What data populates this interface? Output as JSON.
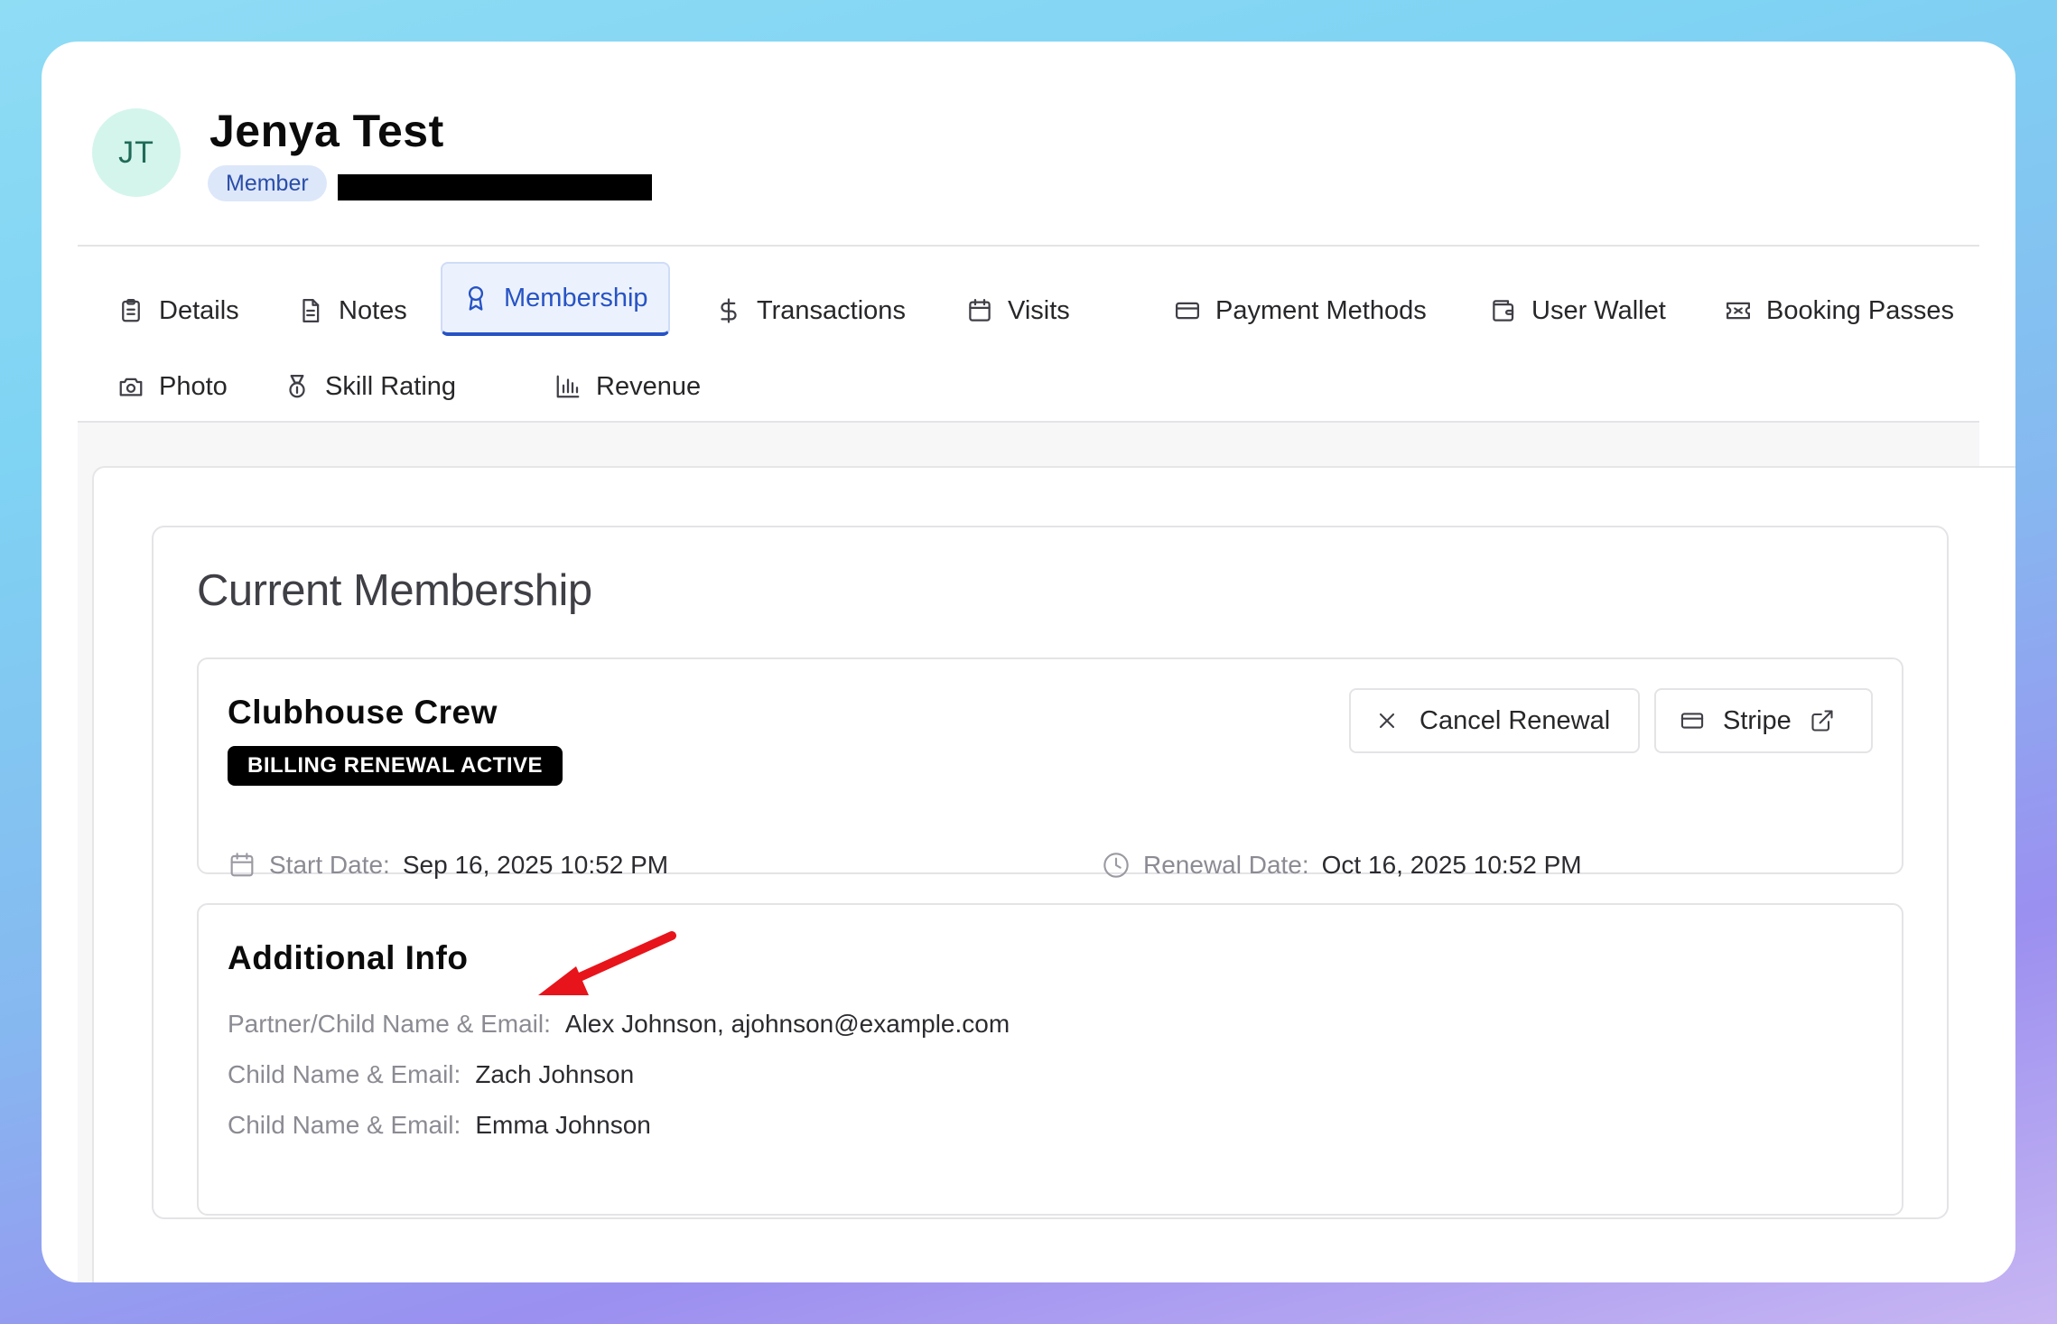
{
  "user": {
    "initials": "JT",
    "name": "Jenya Test",
    "role": "Member"
  },
  "tabs": [
    {
      "label": "Details",
      "icon": "clipboard-icon",
      "active": false
    },
    {
      "label": "Notes",
      "icon": "document-icon",
      "active": false
    },
    {
      "label": "Membership",
      "icon": "award-icon",
      "active": true
    },
    {
      "label": "Transactions",
      "icon": "dollar-icon",
      "active": false
    },
    {
      "label": "Visits",
      "icon": "calendar-icon",
      "active": false
    },
    {
      "label": "Payment Methods",
      "icon": "credit-card-icon",
      "active": false
    },
    {
      "label": "User Wallet",
      "icon": "wallet-icon",
      "active": false
    },
    {
      "label": "Booking Passes",
      "icon": "ticket-icon",
      "active": false
    },
    {
      "label": "Photo",
      "icon": "camera-icon",
      "active": false
    },
    {
      "label": "Skill Rating",
      "icon": "medal-icon",
      "active": false
    },
    {
      "label": "Revenue",
      "icon": "bar-chart-icon",
      "active": false
    }
  ],
  "membership": {
    "section_title": "Current Membership",
    "plan_name": "Clubhouse Crew",
    "status": "BILLING RENEWAL ACTIVE",
    "cancel_label": "Cancel Renewal",
    "stripe_label": "Stripe",
    "start_label": "Start Date:",
    "start_value": "Sep 16, 2025 10:52 PM",
    "renewal_label": "Renewal Date:",
    "renewal_value": "Oct 16, 2025 10:52 PM"
  },
  "additional_info": {
    "title": "Additional Info",
    "rows": [
      {
        "label": "Partner/Child Name & Email:",
        "value": "Alex Johnson, ajohnson@example.com"
      },
      {
        "label": "Child Name & Email:",
        "value": "Zach Johnson"
      },
      {
        "label": "Child Name & Email:",
        "value": "Emma Johnson"
      }
    ]
  },
  "colors": {
    "accent": "#2753c4",
    "annotation_arrow": "#e8141b",
    "status_badge_bg": "#000000"
  }
}
